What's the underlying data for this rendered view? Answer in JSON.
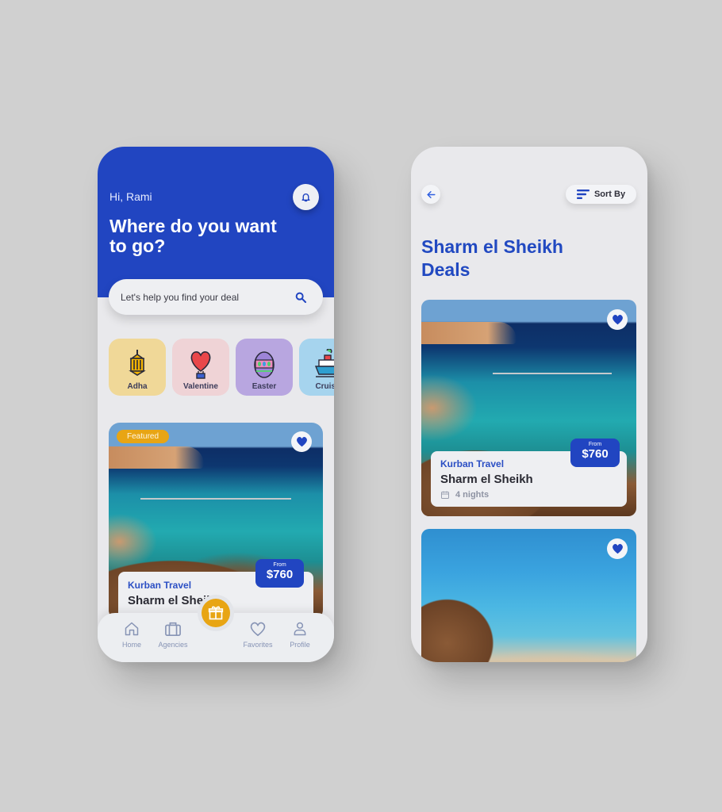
{
  "home_screen": {
    "greeting": "Hi, Rami",
    "headline": "Where do you want to go?",
    "search": {
      "placeholder": "Let's help you find your deal"
    },
    "categories": [
      {
        "label": "Adha",
        "icon": "lantern-icon",
        "color": "#f0d898"
      },
      {
        "label": "Valentine",
        "icon": "heart-balloon-icon",
        "color": "#efd3d6"
      },
      {
        "label": "Easter",
        "icon": "easter-egg-icon",
        "color": "#b8a6e0"
      },
      {
        "label": "Cruise",
        "icon": "ship-icon",
        "color": "#a6d4ee"
      }
    ],
    "featured_deal": {
      "badge": "Featured",
      "agency": "Kurban Travel",
      "destination": "Sharm el Sheikh",
      "price_prefix": "From",
      "price": "$760",
      "favorited": true
    },
    "bottom_nav": [
      {
        "label": "Home",
        "icon": "home-icon"
      },
      {
        "label": "Agencies",
        "icon": "briefcase-icon"
      },
      {
        "label": "Favorites",
        "icon": "heart-outline-icon"
      },
      {
        "label": "Profile",
        "icon": "user-icon"
      }
    ],
    "center_action": {
      "icon": "gift-icon"
    }
  },
  "deals_screen": {
    "sort_label": "Sort By",
    "title": "Sharm el Sheikh Deals",
    "deals": [
      {
        "agency": "Kurban Travel",
        "destination": "Sharm el Sheikh",
        "duration": "4 nights",
        "price_prefix": "From",
        "price": "$760",
        "favorited": true
      },
      {
        "favorited": true
      }
    ]
  },
  "colors": {
    "primary": "#2145c1",
    "accent": "#e8a514",
    "background": "#d0d0d0",
    "screen": "#e9e9ec"
  }
}
